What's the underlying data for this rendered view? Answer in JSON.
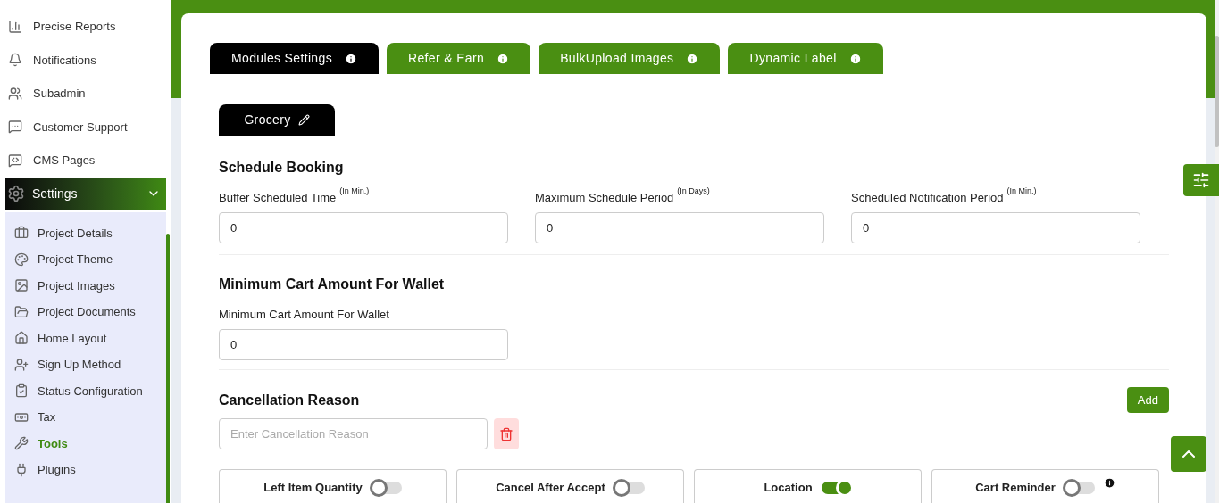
{
  "sidebar": {
    "items": [
      {
        "label": "Precise Reports"
      },
      {
        "label": "Notifications"
      },
      {
        "label": "Subadmin"
      },
      {
        "label": "Customer Support"
      },
      {
        "label": "CMS Pages"
      }
    ],
    "settings": {
      "label": "Settings",
      "expanded": true,
      "children": [
        {
          "label": "Project Details",
          "selected": false
        },
        {
          "label": "Project Theme",
          "selected": false
        },
        {
          "label": "Project Images",
          "selected": false
        },
        {
          "label": "Project Documents",
          "selected": false
        },
        {
          "label": "Home Layout",
          "selected": false
        },
        {
          "label": "Sign Up Method",
          "selected": false
        },
        {
          "label": "Status Configuration",
          "selected": false
        },
        {
          "label": "Tax",
          "selected": false
        },
        {
          "label": "Tools",
          "selected": true
        },
        {
          "label": "Plugins",
          "selected": false
        }
      ]
    }
  },
  "tabs": [
    {
      "label": "Modules Settings",
      "selected": true
    },
    {
      "label": "Refer & Earn",
      "selected": false
    },
    {
      "label": "BulkUpload Images",
      "selected": false
    },
    {
      "label": "Dynamic Label",
      "selected": false
    }
  ],
  "module_tab": {
    "label": "Grocery"
  },
  "schedule_booking": {
    "title": "Schedule Booking",
    "fields": [
      {
        "label": "Buffer Scheduled Time",
        "unit": "(In Min.)",
        "value": "0"
      },
      {
        "label": "Maximum Schedule Period",
        "unit": "(In Days)",
        "value": "0"
      },
      {
        "label": "Scheduled Notification Period",
        "unit": "(In Min.)",
        "value": "0"
      }
    ]
  },
  "wallet": {
    "title": "Minimum Cart Amount For Wallet",
    "fields": [
      {
        "label": "Minimum Cart Amount For Wallet",
        "value": "0"
      }
    ]
  },
  "cancellation": {
    "title": "Cancellation Reason",
    "add_button": "Add",
    "placeholder": "Enter Cancellation Reason"
  },
  "toggles": [
    {
      "label": "Left Item Quantity",
      "on": false,
      "info": false
    },
    {
      "label": "Cancel After Accept",
      "on": false,
      "info": false
    },
    {
      "label": "Location",
      "on": true,
      "info": false
    },
    {
      "label": "Cart Reminder",
      "on": false,
      "info": true
    }
  ]
}
